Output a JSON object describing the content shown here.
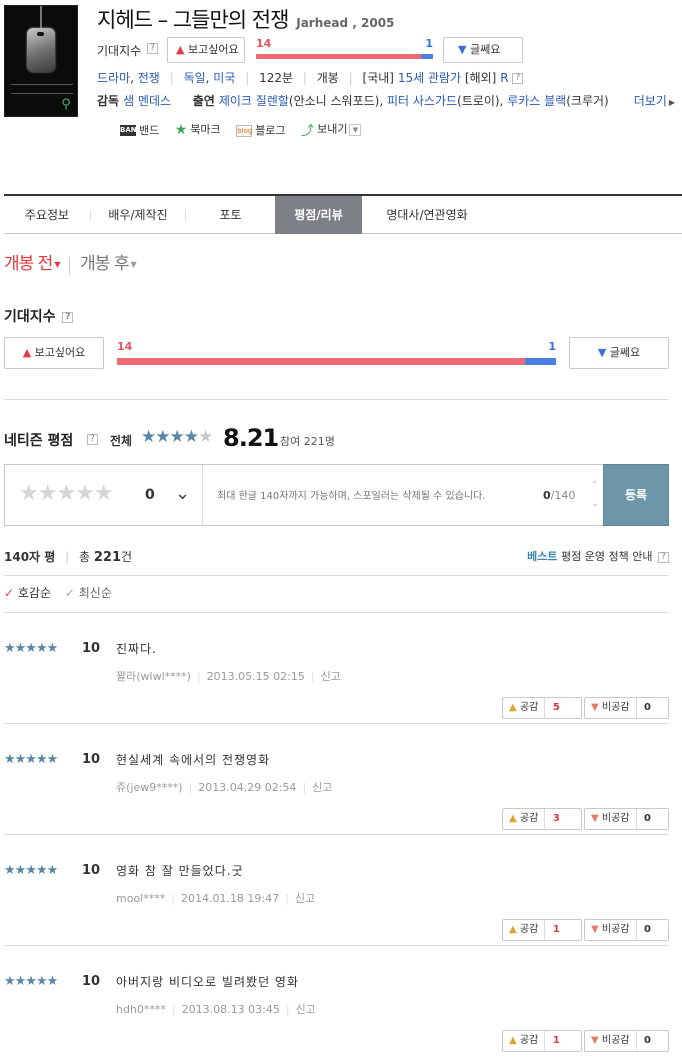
{
  "movie": {
    "title_ko": "지헤드 – 그들만의 전쟁",
    "title_en": "Jarhead , 2005"
  },
  "expectation": {
    "label": "기대지수",
    "want_button": "보고싶어요",
    "not_button": "글쎄요",
    "want_count": "14",
    "not_count": "1",
    "want_ratio": 0.93
  },
  "meta": {
    "genre1": "드라마",
    "genre2": "전쟁",
    "country1": "독일",
    "country2": "미국",
    "runtime": "122분",
    "release": "개봉",
    "rating_kr_prefix": "[국내]",
    "rating_kr": "15세 관람가",
    "rating_world_prefix": "[해외]",
    "rating_world": "R"
  },
  "people": {
    "director_label": "감독",
    "director": "샘 멘데스",
    "cast_label": "출연",
    "cast1": "제이크 질렌할",
    "cast1_role": "(안소니 스워포드),",
    "cast2": "피터 사스가드",
    "cast2_role": "(트로이),",
    "cast3": "루카스 블랙",
    "cast3_role": "(크루거)",
    "more": "더보기"
  },
  "share": {
    "band": "밴드",
    "bookmark": "북마크",
    "blog": "블로그",
    "send": "보내기"
  },
  "tabs": [
    "주요정보",
    "배우/제작진",
    "포토",
    "평점/리뷰",
    "명대사/연관영화"
  ],
  "open_toggle": {
    "before": "개봉 전",
    "after": "개봉 후"
  },
  "netizen": {
    "title": "네티즌 평점",
    "all_label": "전체",
    "score": "8.21",
    "participants": "참여 221명",
    "star_value": "0",
    "placeholder": "최대 한글 140자까지 가능하며, 스포일러는 삭제될 수 있습니다.",
    "count_current": "0",
    "count_max": "/140",
    "submit": "등록"
  },
  "list": {
    "label": "140자 평",
    "total_label": "총",
    "total": "221",
    "total_unit": "건",
    "best": "베스트",
    "policy": "평점 운영 정책 안내",
    "sort_good": "호감순",
    "sort_recent": "최신순"
  },
  "reviews": [
    {
      "score": "10",
      "text": "진짜다.",
      "author": "꽐라(wlwl****)",
      "date": "2013.05.15 02:15",
      "report": "신고",
      "like_label": "공감",
      "like": "5",
      "dislike_label": "비공감",
      "dislike": "0"
    },
    {
      "score": "10",
      "text": "현실세계 속에서의 전쟁영화",
      "author": "쥬(jew9****)",
      "date": "2013.04.29 02:54",
      "report": "신고",
      "like_label": "공감",
      "like": "3",
      "dislike_label": "비공감",
      "dislike": "0"
    },
    {
      "score": "10",
      "text": "영화 참 잘 만들었다.굿",
      "author": "mool****",
      "date": "2014.01.18 19:47",
      "report": "신고",
      "like_label": "공감",
      "like": "1",
      "dislike_label": "비공감",
      "dislike": "0"
    },
    {
      "score": "10",
      "text": "아버지랑 비디오로 빌려봤던 영화",
      "author": "hdh0****",
      "date": "2013.08.13 03:45",
      "report": "신고",
      "like_label": "공감",
      "like": "1",
      "dislike_label": "비공감",
      "dislike": "0"
    }
  ],
  "colors": {
    "accent_red": "#e8383e",
    "bar_red": "#ef6a72",
    "bar_blue": "#4b7fe0",
    "tab_active": "#7d8187",
    "submit_bg": "#6e96aa",
    "star_blue": "#5b86a8"
  }
}
